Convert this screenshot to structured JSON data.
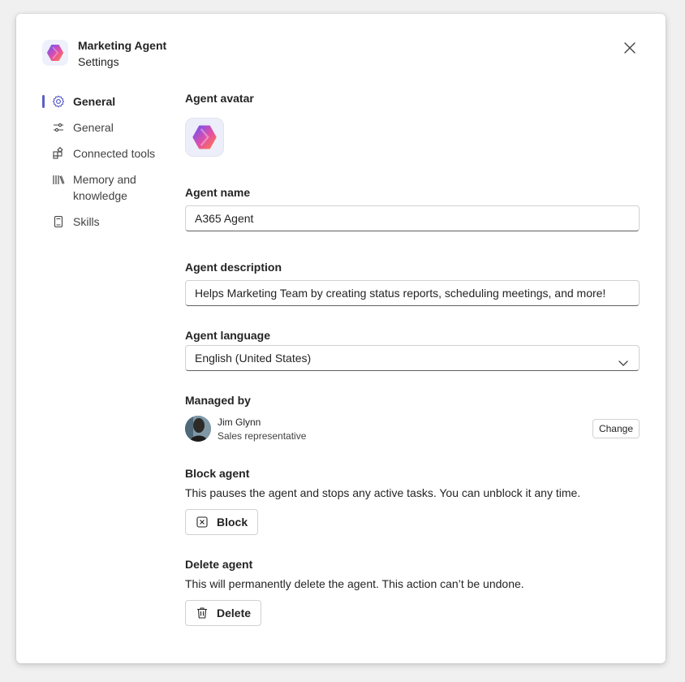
{
  "header": {
    "title": "Marketing Agent",
    "subtitle": "Settings"
  },
  "nav": {
    "items": [
      {
        "label": "General",
        "icon": "settings-gear-icon",
        "active": true
      },
      {
        "label": "General",
        "icon": "sliders-icon",
        "active": false
      },
      {
        "label": "Connected tools",
        "icon": "apps-add-icon",
        "active": false
      },
      {
        "label": "Memory and knowledge",
        "icon": "library-books-icon",
        "active": false
      },
      {
        "label": "Skills",
        "icon": "notebook-icon",
        "active": false
      }
    ]
  },
  "avatar": {
    "label": "Agent avatar"
  },
  "name": {
    "label": "Agent name",
    "value": "A365 Agent"
  },
  "description": {
    "label": "Agent description",
    "value": "Helps Marketing Team by creating status reports, scheduling meetings, and more!"
  },
  "language": {
    "label": "Agent language",
    "value": "English (United States)"
  },
  "managed": {
    "label": "Managed by",
    "person_name": "Jim Glynn",
    "person_role": "Sales representative",
    "change_label": "Change"
  },
  "block": {
    "label": "Block agent",
    "description": "This pauses the agent and stops any active tasks. You can unblock it any time.",
    "button_label": "Block"
  },
  "delete": {
    "label": "Delete agent",
    "description": "This will permanently delete the agent. This action can’t be undone.",
    "button_label": "Delete"
  },
  "colors": {
    "accent": "#5b5fc7",
    "logo_pink": "#f0528a",
    "logo_purple": "#7b4df2"
  }
}
